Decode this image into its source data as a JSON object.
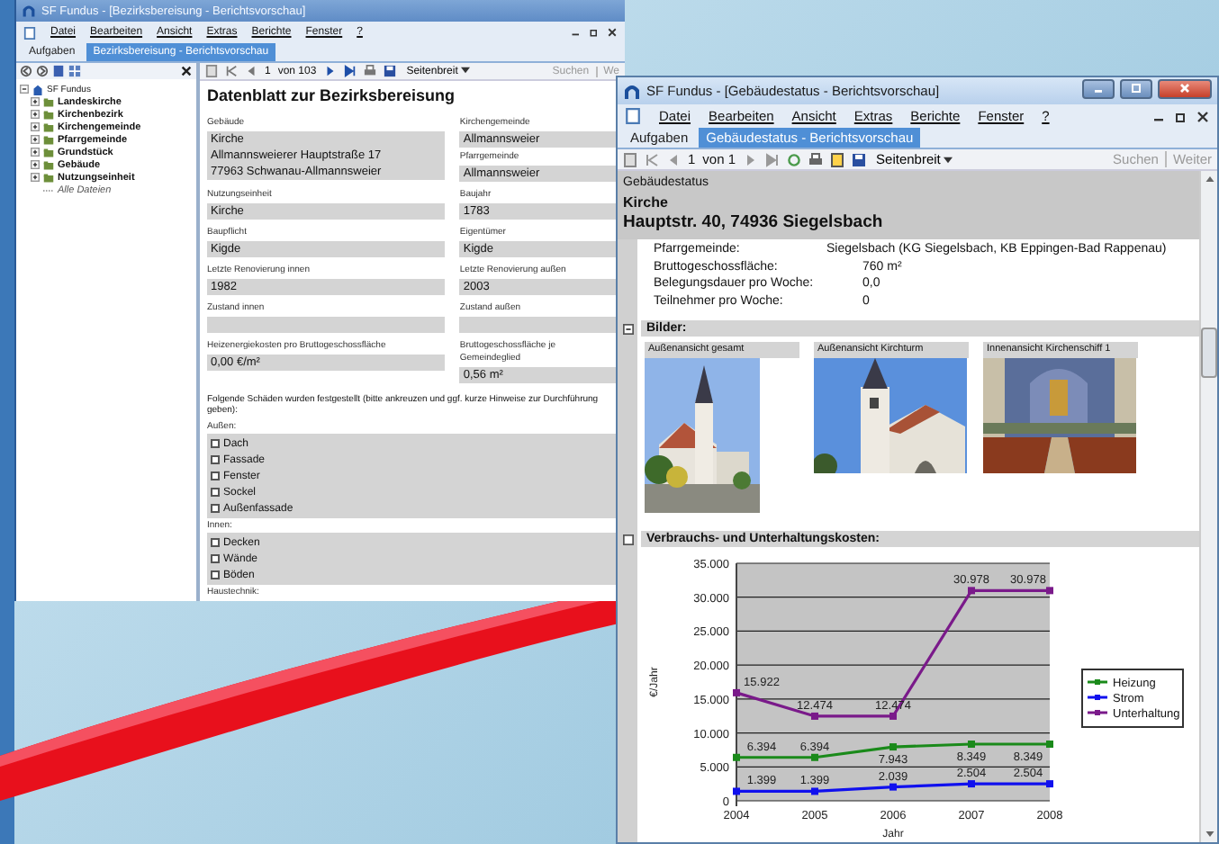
{
  "background_window": {
    "title": "SF Fundus - [Bezirksbereisung - Berichtsvorschau]",
    "menu": [
      "Datei",
      "Bearbeiten",
      "Ansicht",
      "Extras",
      "Berichte",
      "Fenster",
      "?"
    ],
    "tabs": [
      {
        "label": "Aufgaben",
        "selected": false
      },
      {
        "label": "Bezirksbereisung - Berichtsvorschau",
        "selected": true
      }
    ],
    "tree": {
      "label": "SF Fundus",
      "expanded": true,
      "children": [
        {
          "label": "Landeskirche",
          "expanded": false
        },
        {
          "label": "Kirchenbezirk",
          "expanded": false
        },
        {
          "label": "Kirchengemeinde",
          "expanded": false
        },
        {
          "label": "Pfarrgemeinde",
          "expanded": false
        },
        {
          "label": "Grundstück",
          "expanded": false
        },
        {
          "label": "Gebäude",
          "expanded": false
        },
        {
          "label": "Nutzungseinheit",
          "expanded": false
        },
        {
          "label": "Alle Dateien",
          "kind": "files"
        }
      ]
    },
    "toolbar": {
      "page": "1",
      "page_count": "von 103",
      "zoom": "Seitenbreit",
      "search": "Suchen",
      "next": "We"
    },
    "report": {
      "title": "Datenblatt zur Bezirksbereisung",
      "rows": [
        {
          "left": [
            {
              "label": "Gebäude",
              "lines": [
                "Kirche",
                "Allmannsweierer Hauptstraße 17",
                "77963 Schwanau-Allmannsweier"
              ]
            }
          ],
          "right": [
            {
              "label": "Kirchengemeinde",
              "lines": [
                "Allmannsweier"
              ]
            },
            {
              "label": "Pfarrgemeinde",
              "lines": [
                "Allmannsweier"
              ]
            }
          ]
        },
        {
          "left": [
            {
              "label": "Nutzungseinheit",
              "lines": [
                "Kirche"
              ]
            }
          ],
          "right": [
            {
              "label": "Baujahr",
              "lines": [
                "1783"
              ]
            }
          ]
        },
        {
          "left": [
            {
              "label": "Baupflicht",
              "lines": [
                "Kigde"
              ]
            }
          ],
          "right": [
            {
              "label": "Eigentümer",
              "lines": [
                "Kigde"
              ]
            }
          ]
        },
        {
          "left": [
            {
              "label": "Letzte Renovierung innen",
              "lines": [
                "1982"
              ]
            }
          ],
          "right": [
            {
              "label": "Letzte Renovierung außen",
              "lines": [
                "2003"
              ]
            }
          ]
        },
        {
          "left": [
            {
              "label": "Zustand innen"
            }
          ],
          "right": [
            {
              "label": "Zustand außen"
            }
          ]
        },
        {
          "left": [
            {
              "label": "Heizenergiekosten pro Bruttogeschossfläche",
              "lines": [
                "0,00 €/m²"
              ]
            }
          ],
          "right": [
            {
              "label": "Bruttogeschossfläche je Gemeindeglied",
              "lines": [
                "0,56 m²"
              ]
            }
          ]
        }
      ],
      "note": "Folgende Schäden wurden festgestellt (bitte ankreuzen und ggf. kurze Hinweise zur Durchführung geben):",
      "groups": [
        {
          "label": "Außen:",
          "items": [
            {
              "label": "Dach",
              "checked": false
            },
            {
              "label": "Fassade",
              "checked": false
            },
            {
              "label": "Fenster",
              "checked": false
            },
            {
              "label": "Sockel",
              "checked": false
            },
            {
              "label": "Außenfassade",
              "checked": false
            }
          ]
        },
        {
          "label": "Innen:",
          "items": [
            {
              "label": "Decken",
              "checked": false
            },
            {
              "label": "Wände",
              "checked": false
            },
            {
              "label": "Böden",
              "checked": false
            }
          ]
        },
        {
          "label": "Haustechnik:"
        }
      ]
    }
  },
  "front_window": {
    "title": "SF Fundus - [Gebäudestatus - Berichtsvorschau]",
    "menu": [
      "Datei",
      "Bearbeiten",
      "Ansicht",
      "Extras",
      "Berichte",
      "Fenster",
      "?"
    ],
    "tabs": [
      {
        "label": "Aufgaben",
        "selected": false
      },
      {
        "label": "Gebäudestatus - Berichtsvorschau",
        "selected": true
      }
    ],
    "toolbar": {
      "page": "1",
      "page_count": "von 1",
      "zoom": "Seitenbreit",
      "search": "Suchen",
      "next": "Weiter"
    },
    "report": {
      "section": "Gebäudestatus",
      "name": "Kirche",
      "address": "Hauptstr. 40, 74936 Siegelsbach",
      "details": [
        {
          "label": "Pfarrgemeinde:",
          "value": "Siegelsbach (KG Siegelsbach, KB Eppingen-Bad Rappenau)"
        },
        {
          "label": "Bruttogeschossfläche:",
          "value": "760  m²"
        },
        {
          "label": "Belegungsdauer pro Woche:",
          "value": "0,0"
        },
        {
          "label": "Teilnehmer pro Woche:",
          "value": "0"
        }
      ],
      "images_section": {
        "title": "Bilder:",
        "images": [
          {
            "caption": "Außenansicht gesamt",
            "kind": "exterior"
          },
          {
            "caption": "Außenansicht Kirchturm",
            "kind": "tower"
          },
          {
            "caption": "Innenansicht Kirchenschiff 1",
            "kind": "interior"
          }
        ]
      },
      "costs_section": {
        "title": "Verbrauchs- und Unterhaltungskosten:",
        "chart_data": {
          "type": "line",
          "xlabel": "Jahr",
          "ylabel": "€/Jahr",
          "x": [
            "2004",
            "2005",
            "2006",
            "2007",
            "2008"
          ],
          "ylim": [
            0,
            35000
          ],
          "yticks": [
            {
              "value": 0,
              "label": "0"
            },
            {
              "value": 5000,
              "label": "5.000"
            },
            {
              "value": 10000,
              "label": "10.000"
            },
            {
              "value": 15000,
              "label": "15.000"
            },
            {
              "value": 20000,
              "label": "20.000"
            },
            {
              "value": 25000,
              "label": "25.000"
            },
            {
              "value": 30000,
              "label": "30.000"
            },
            {
              "value": 35000,
              "label": "35.000"
            }
          ],
          "data_labels": "value_labels",
          "grid": true,
          "legend": true,
          "series": [
            {
              "name": "Heizung",
              "color": "#1a8a1a",
              "marker": "square",
              "values": [
                6394,
                6394,
                7943,
                8349,
                8349
              ],
              "value_labels": [
                "6.394",
                "6.394",
                "7.943",
                "8.349",
                "8.349"
              ]
            },
            {
              "name": "Strom",
              "color": "#1010ee",
              "marker": "square",
              "values": [
                1399,
                1399,
                2039,
                2504,
                2504
              ],
              "value_labels": [
                "1.399",
                "1.399",
                "2.039",
                "2.504",
                "2.504"
              ]
            },
            {
              "name": "Unterhaltung",
              "color": "#7a1a8a",
              "marker": "square",
              "values": [
                15922,
                12474,
                12474,
                30978,
                30978
              ],
              "value_labels": [
                "15.922",
                "12.474",
                "12.474",
                "30.978",
                "30.978"
              ]
            }
          ]
        }
      }
    }
  }
}
